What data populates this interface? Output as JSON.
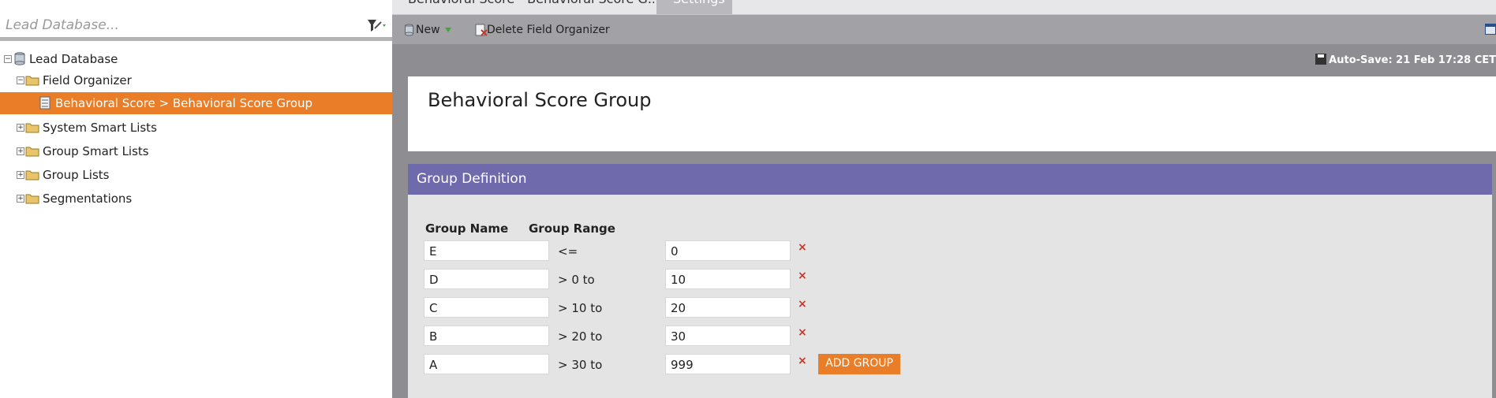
{
  "search": {
    "placeholder": "Lead Database..."
  },
  "tree": {
    "items": [
      {
        "label": "Lead Database",
        "expander": "−"
      },
      {
        "label": "Field Organizer",
        "expander": "−"
      },
      {
        "label": "Behavioral Score > Behavioral Score Group"
      },
      {
        "label": "System Smart Lists",
        "expander": "+"
      },
      {
        "label": "Group Smart Lists",
        "expander": "+"
      },
      {
        "label": "Group Lists",
        "expander": "+"
      },
      {
        "label": "Segmentations",
        "expander": "+"
      }
    ]
  },
  "tabs": [
    {
      "label": "Behavioral Score - Behavioral Score G..."
    },
    {
      "label": "Settings"
    }
  ],
  "toolbar": {
    "new_label": "New",
    "delete_label": "Delete Field Organizer"
  },
  "autosave": "Auto-Save: 21 Feb 17:28 CET",
  "page_title": "Behavioral Score Group",
  "group_definition": {
    "header": "Group Definition",
    "col_name": "Group Name",
    "col_range": "Group Range",
    "rows": [
      {
        "name": "E",
        "op": "<=",
        "value": "0"
      },
      {
        "name": "D",
        "op": "> 0 to",
        "value": "10"
      },
      {
        "name": "C",
        "op": "> 10 to",
        "value": "20"
      },
      {
        "name": "B",
        "op": "> 20 to",
        "value": "30"
      },
      {
        "name": "A",
        "op": "> 30 to",
        "value": "999"
      }
    ],
    "delete_glyph": "×",
    "add_group_label": "ADD GROUP"
  },
  "colors": {
    "accent_orange": "#ea7d27",
    "header_purple": "#6f6aac",
    "delete_red": "#c0392b"
  }
}
